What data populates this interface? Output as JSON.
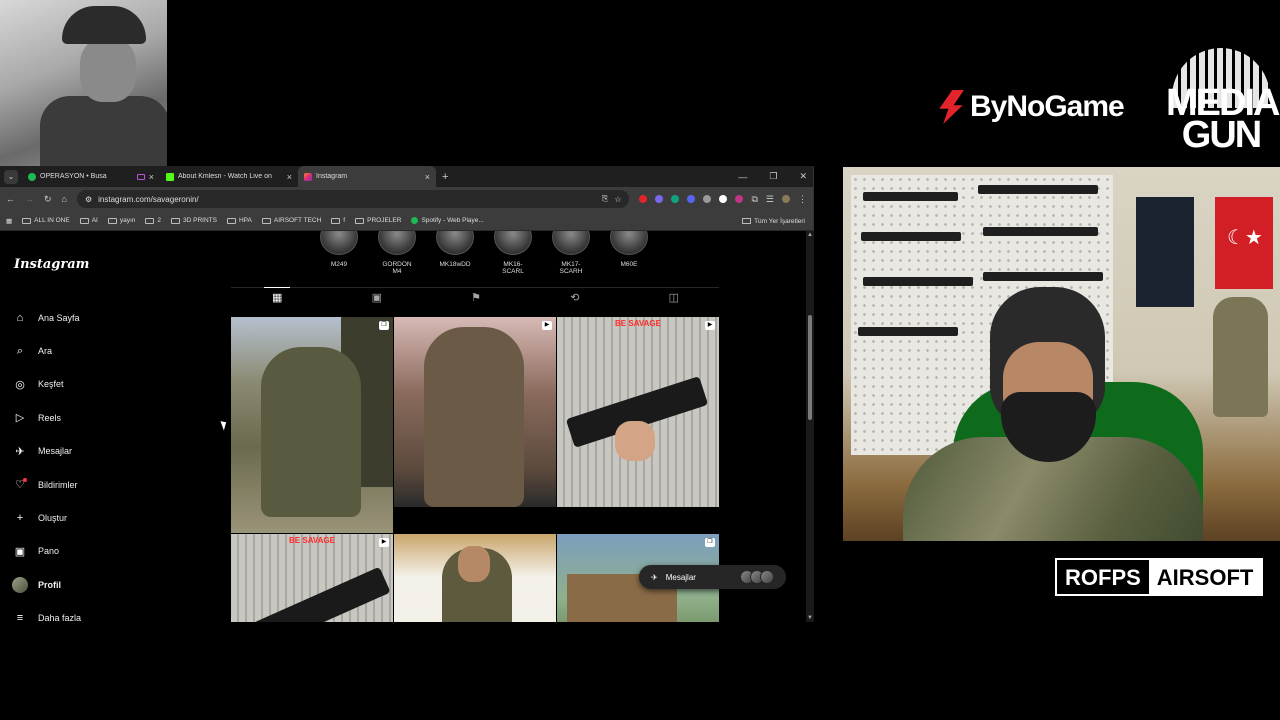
{
  "overlay": {
    "brand_left": "ByNoGame",
    "brand_right_line1": "MEDIA",
    "brand_right_line2": "GUN",
    "sponsor_a": "ROFPS",
    "sponsor_b": "AIRSOFT"
  },
  "browser": {
    "tabs": [
      {
        "label": "OPERASYON • Busa",
        "favicon_color": "#1db954"
      },
      {
        "label": "About Kmlesn - Watch Live on",
        "favicon_color": "#53fc18"
      },
      {
        "label": "Instagram",
        "favicon_color": "#e1306c"
      }
    ],
    "address": "instagram.com/savageronin/",
    "bookmarks": [
      "ALL IN ONE",
      "AI",
      "yayın",
      "2",
      "3D PRINTS",
      "HPA",
      "AIRSOFT TECH",
      "f",
      "PROJELER",
      "Spotify - Web Playe..."
    ],
    "bookmarks_right": "Tüm Yer İşaretleri"
  },
  "instagram": {
    "logo": "Instagram",
    "nav": [
      {
        "label": "Ana Sayfa",
        "icon": "home-icon",
        "glyph": "⌂"
      },
      {
        "label": "Ara",
        "icon": "search-icon",
        "glyph": "⌕"
      },
      {
        "label": "Keşfet",
        "icon": "explore-icon",
        "glyph": "◎"
      },
      {
        "label": "Reels",
        "icon": "reels-icon",
        "glyph": "▷"
      },
      {
        "label": "Mesajlar",
        "icon": "messages-icon",
        "glyph": "✈"
      },
      {
        "label": "Bildirimler",
        "icon": "heart-icon",
        "glyph": "♡"
      },
      {
        "label": "Oluştur",
        "icon": "plus-icon",
        "glyph": "+"
      },
      {
        "label": "Pano",
        "icon": "dashboard-icon",
        "glyph": "▣"
      },
      {
        "label": "Profil",
        "icon": "avatar",
        "glyph": ""
      },
      {
        "label": "Daha fazla",
        "icon": "menu-icon",
        "glyph": "≡"
      }
    ],
    "highlights": [
      "M249",
      "GORDON M4",
      "MK18wDD",
      "MK16-SCARL",
      "MK17-SCARH",
      "M60E"
    ],
    "profile_tabs": [
      {
        "name": "grid-icon",
        "glyph": "▦"
      },
      {
        "name": "reels-tab-icon",
        "glyph": "▣"
      },
      {
        "name": "saved-icon",
        "glyph": "⚑"
      },
      {
        "name": "reposts-icon",
        "glyph": "⟲"
      },
      {
        "name": "tagged-icon",
        "glyph": "◫"
      }
    ],
    "posts": [
      {
        "caption": ""
      },
      {
        "caption": ""
      },
      {
        "caption": "BE SAVAGE"
      },
      {
        "caption": "BE SAVAGE"
      },
      {
        "caption": ""
      },
      {
        "caption": ""
      }
    ],
    "messages_pill": "Mesajlar"
  }
}
